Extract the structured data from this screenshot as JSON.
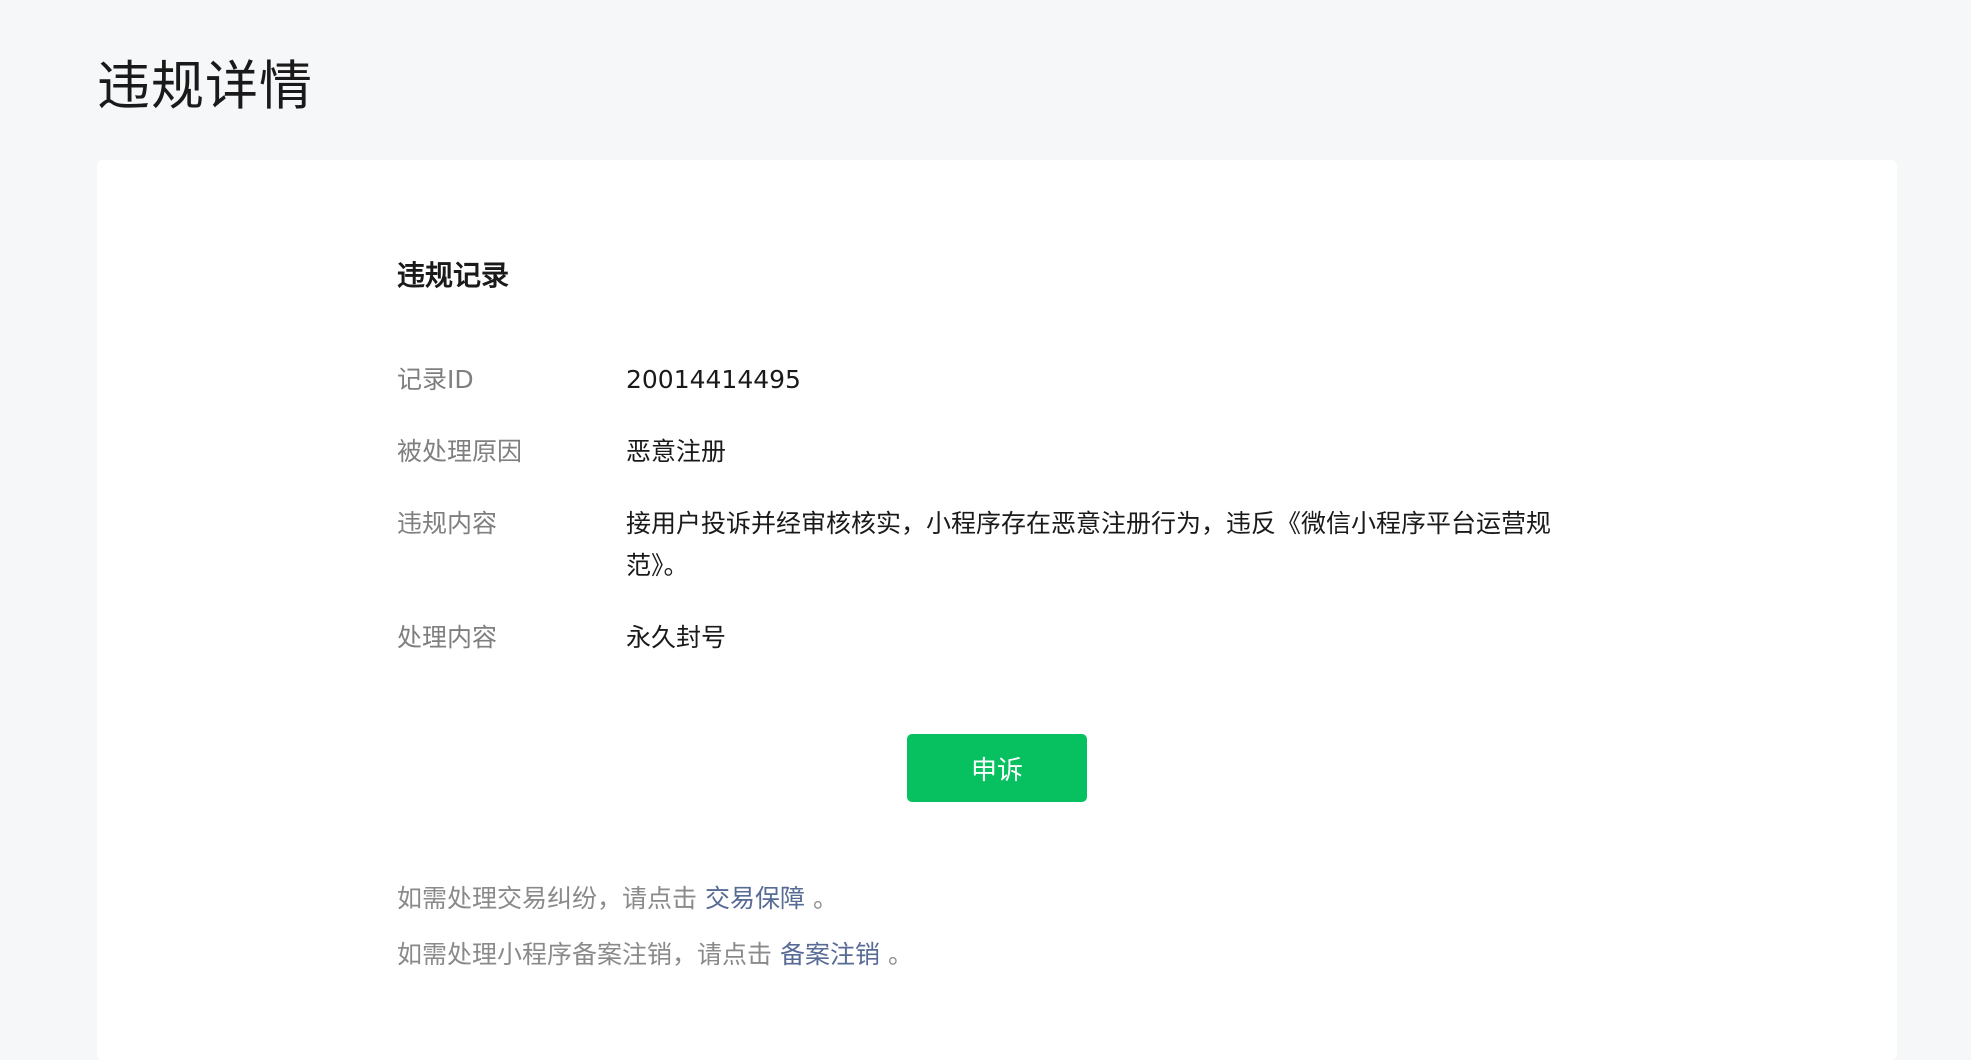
{
  "page": {
    "title": "违规详情"
  },
  "record": {
    "section_title": "违规记录",
    "fields": [
      {
        "label": "记录ID",
        "value": "20014414495"
      },
      {
        "label": "被处理原因",
        "value": "恶意注册"
      },
      {
        "label": "违规内容",
        "value": "接用户投诉并经审核核实，小程序存在恶意注册行为，违反《微信小程序平台运营规范》。"
      },
      {
        "label": "处理内容",
        "value": "永久封号"
      }
    ],
    "appeal_button_label": "申诉"
  },
  "notes": [
    {
      "prefix": "如需处理交易纠纷，请点击",
      "link": "交易保障",
      "suffix": "。"
    },
    {
      "prefix": "如需处理小程序备案注销，请点击",
      "link": "备案注销",
      "suffix": "。"
    }
  ],
  "colors": {
    "background": "#f6f7f9",
    "card": "#ffffff",
    "primary_button": "#07c160",
    "link": "#576b95",
    "label_text": "#7f7f7f"
  }
}
